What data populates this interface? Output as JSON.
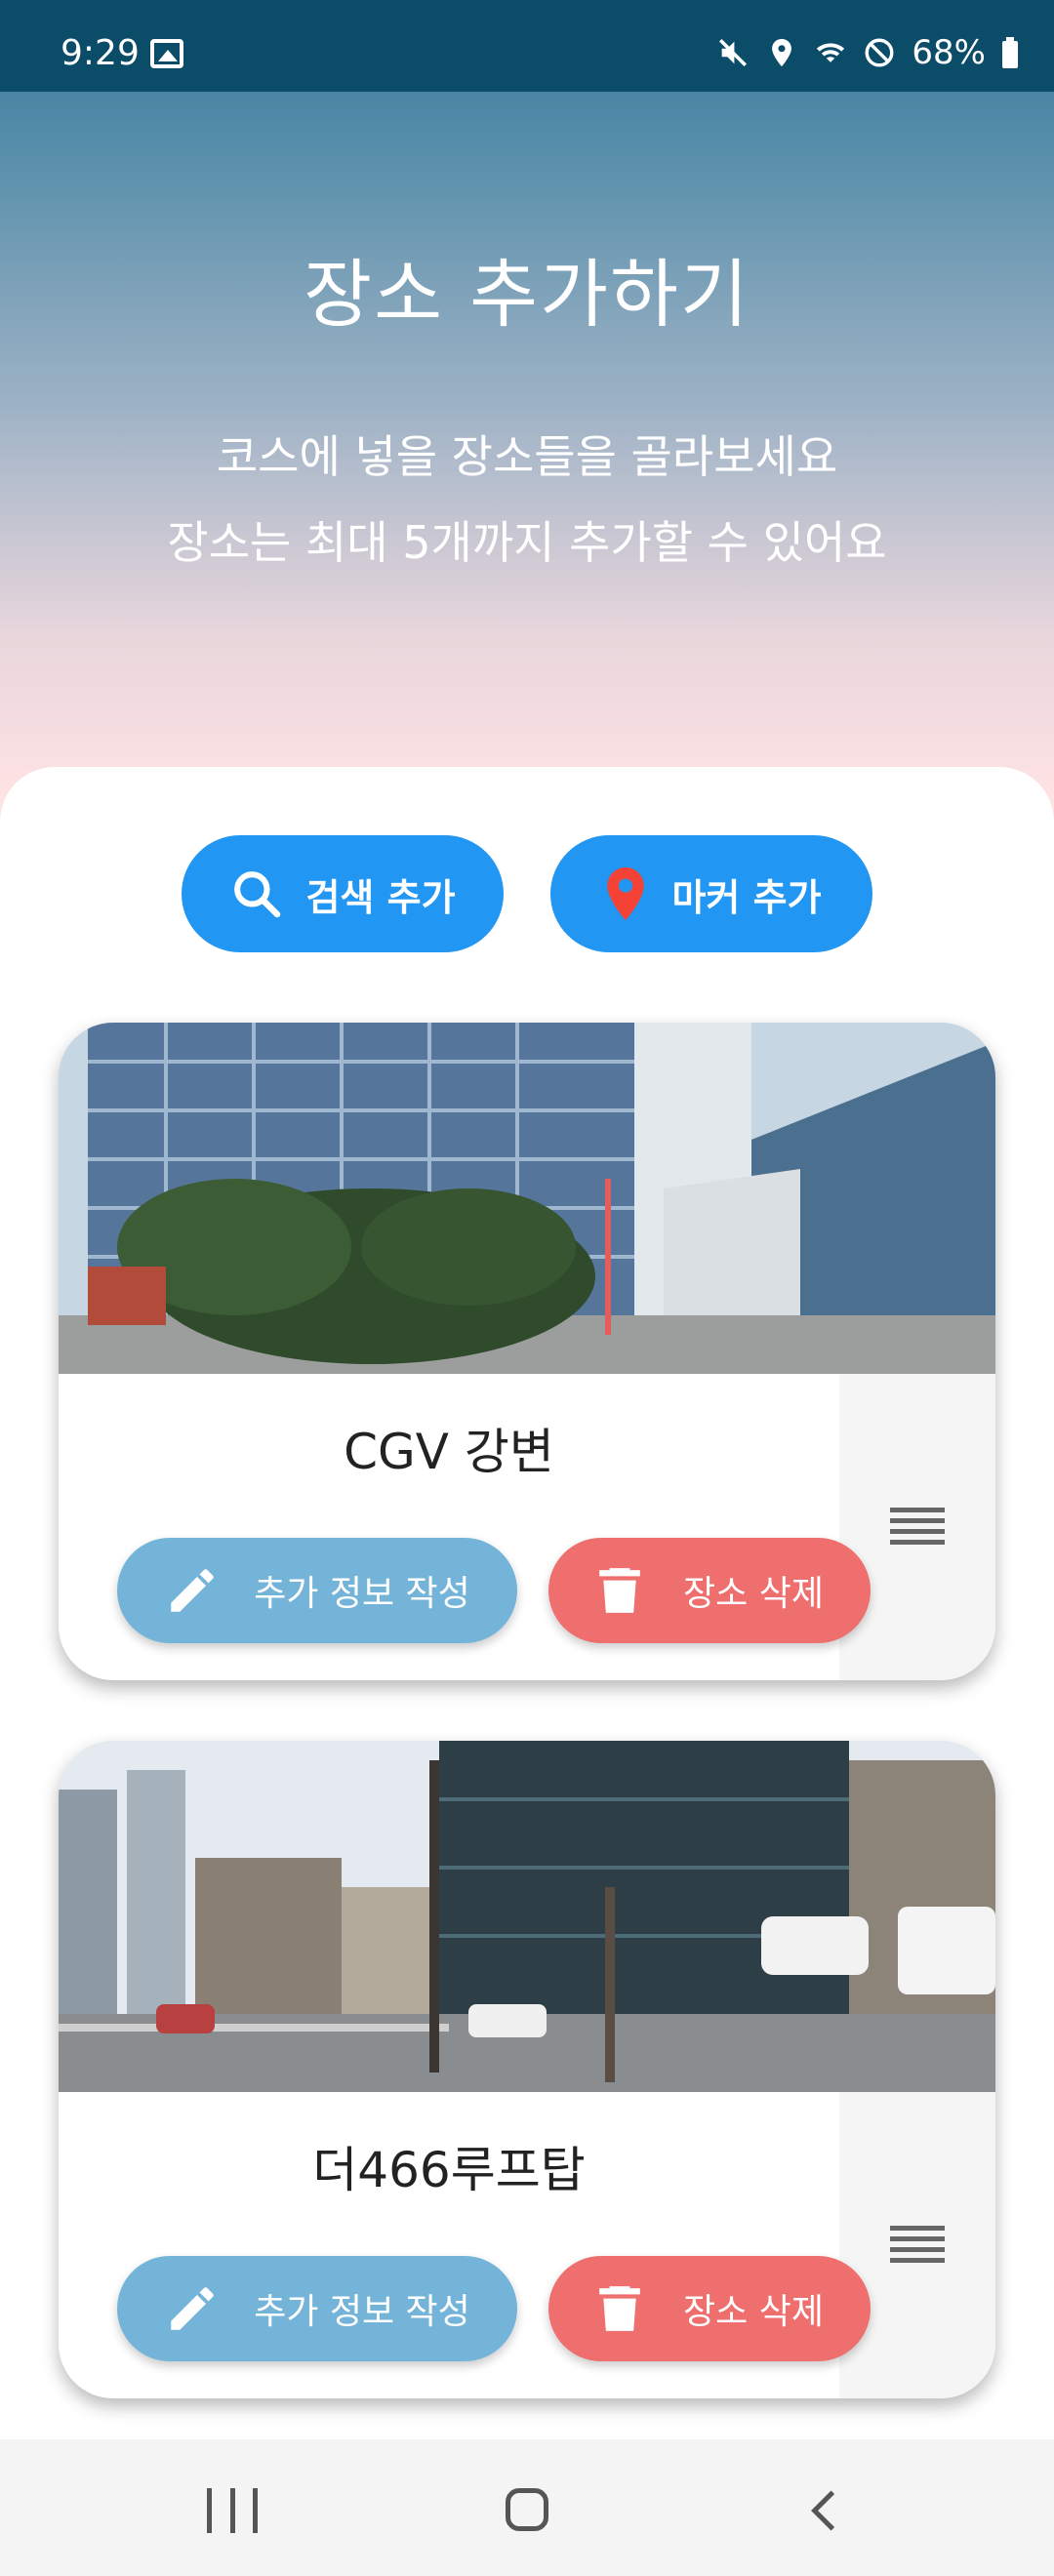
{
  "status_bar": {
    "time": "9:29",
    "battery": "68%"
  },
  "header": {
    "title": "장소 추가하기",
    "subtitle_line1": "코스에 넣을 장소들을 골라보세요",
    "subtitle_line2": "장소는 최대 5개까지 추가할 수 있어요"
  },
  "actions": {
    "search_add": "검색 추가",
    "marker_add": "마커 추가"
  },
  "places": [
    {
      "name": "CGV 강변",
      "info_button": "추가 정보 작성",
      "delete_button": "장소 삭제"
    },
    {
      "name": "더466루프탑",
      "info_button": "추가 정보 작성",
      "delete_button": "장소 삭제"
    }
  ],
  "colors": {
    "status_bar": "#0b4c69",
    "primary_blue": "#2196f3",
    "info_button": "#75b4d9",
    "delete_button": "#ef6e6e",
    "marker_pin": "#f44336"
  },
  "icons": {
    "search_add": "search-icon",
    "marker_add": "location-pin-icon",
    "info": "pencil-icon",
    "delete": "trash-icon",
    "drag": "drag-handle-icon"
  }
}
